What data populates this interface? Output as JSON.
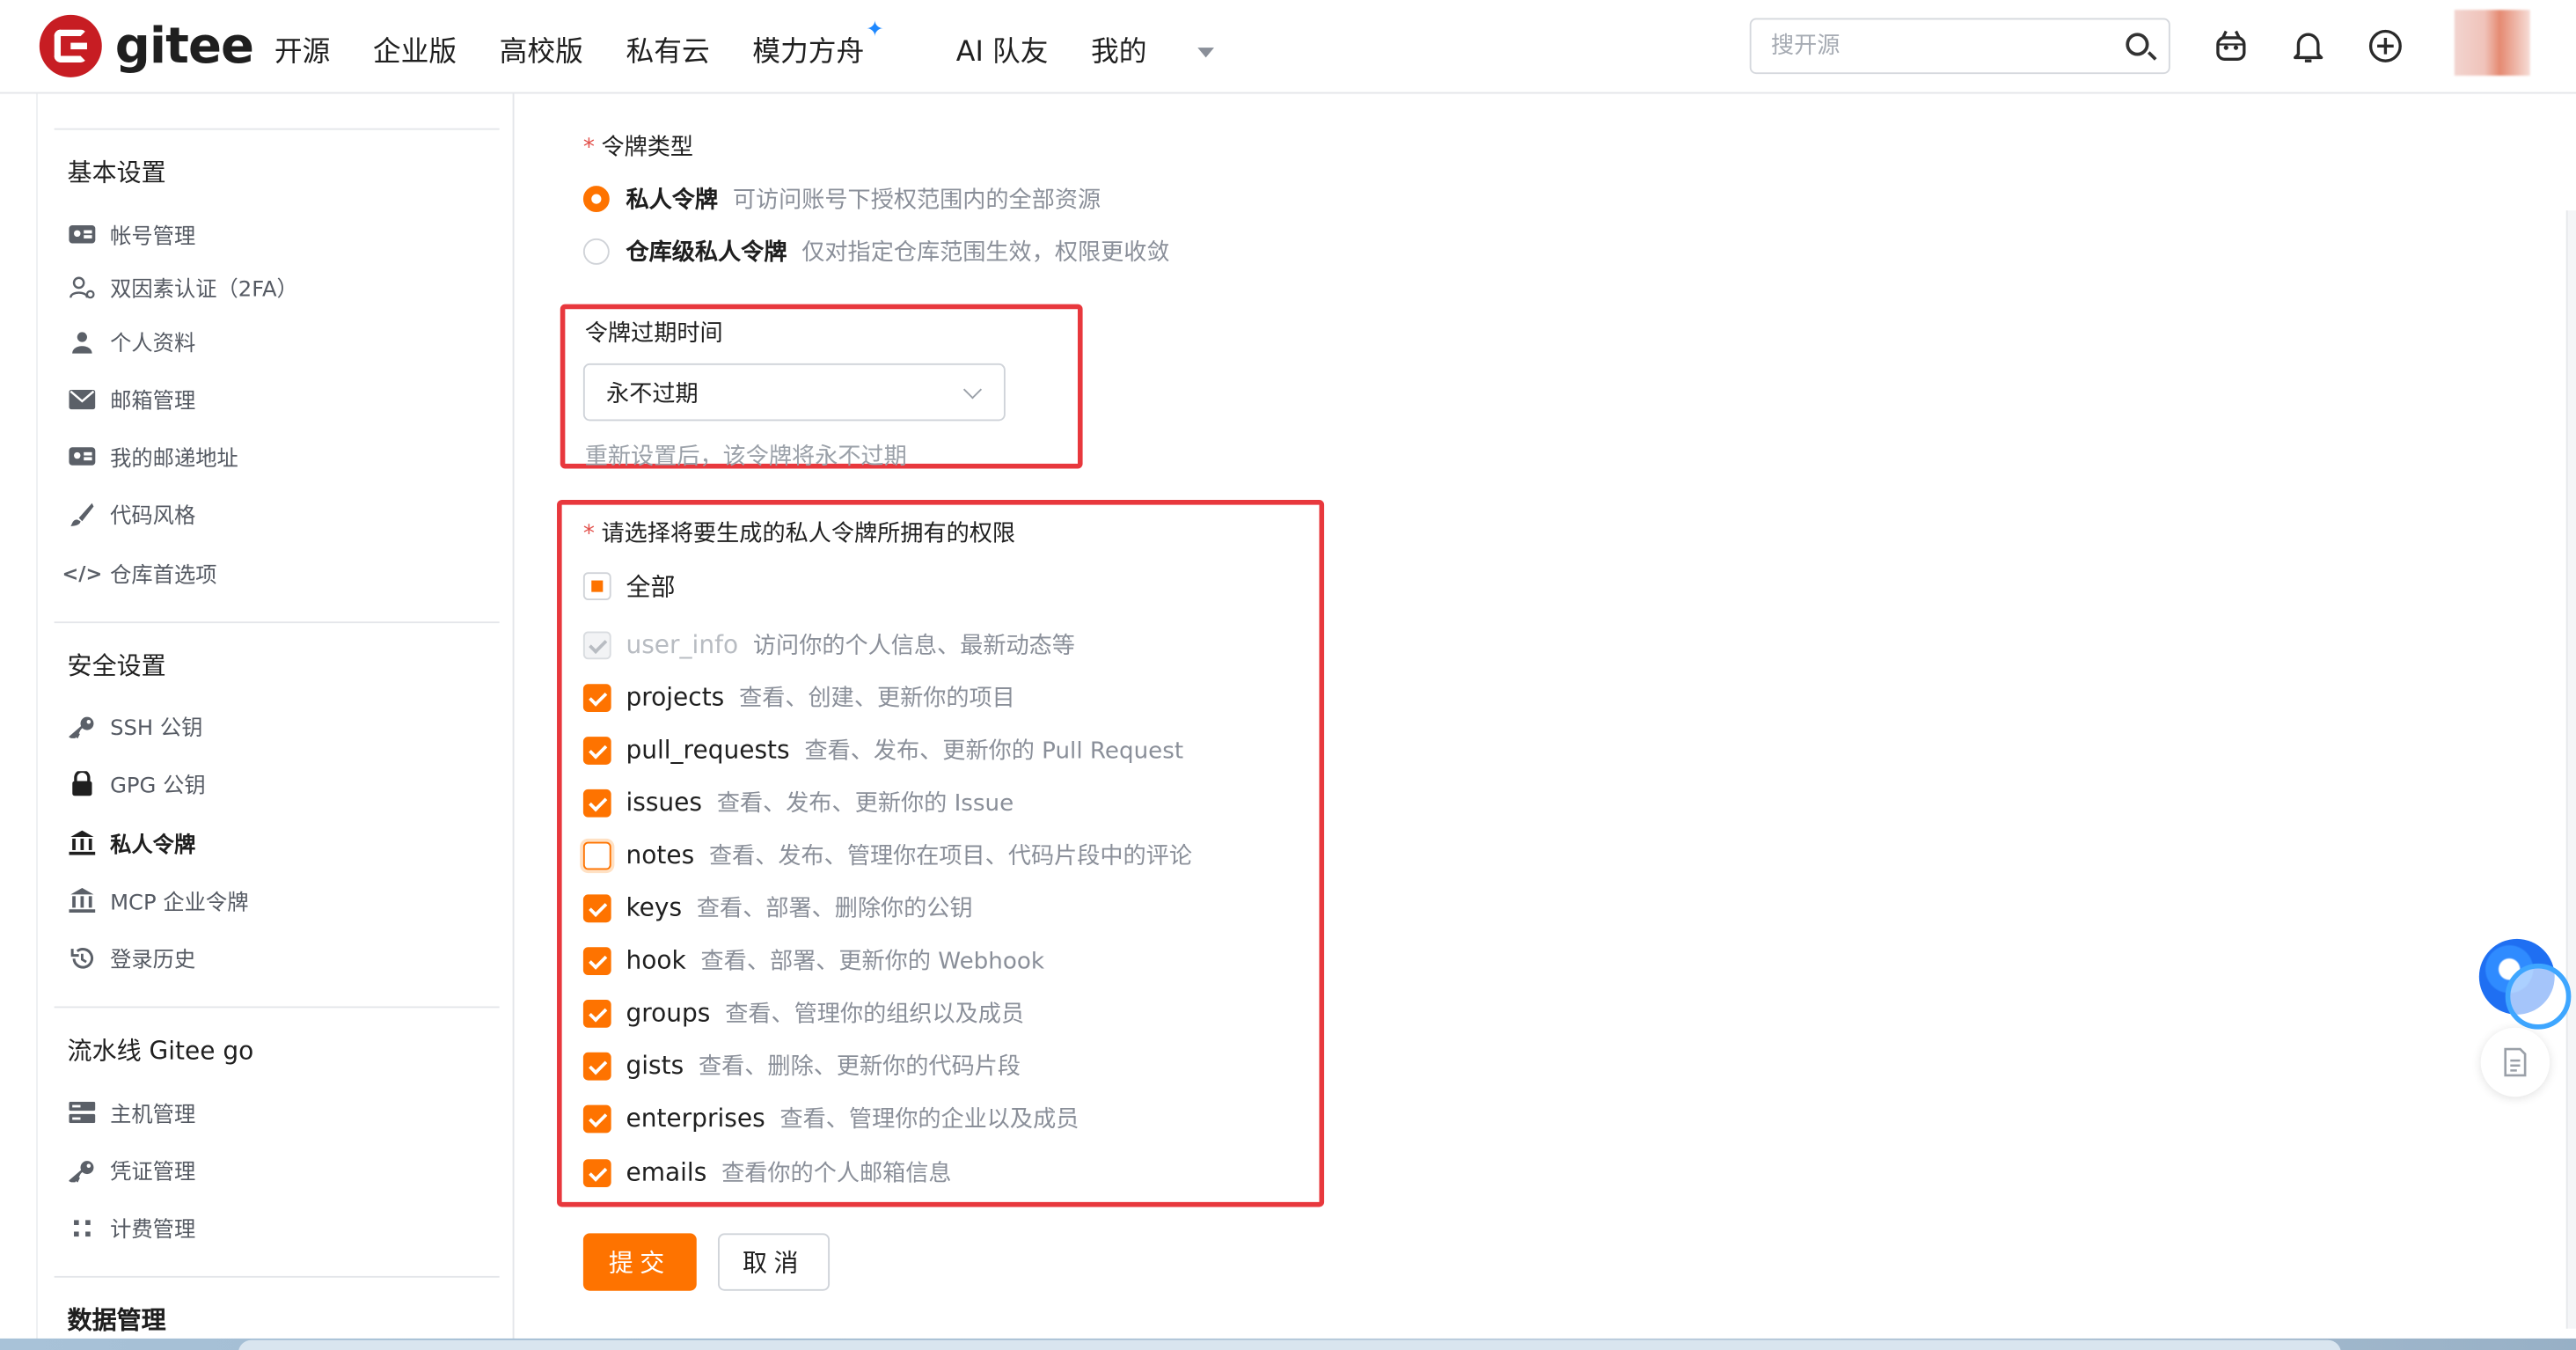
{
  "brand": {
    "name": "gitee",
    "accent": "#fe7300",
    "logo_red": "#c71d23"
  },
  "nav": {
    "items": [
      "开源",
      "企业版",
      "高校版",
      "私有云",
      "模力方舟",
      "AI 队友",
      "我的"
    ],
    "search_placeholder": "搜开源",
    "icons": [
      "search-icon",
      "robot-icon",
      "bell-icon",
      "plus-circle-icon",
      "avatar"
    ]
  },
  "sidebar": {
    "sections": [
      {
        "title": "基本设置",
        "items": [
          {
            "label": "帐号管理",
            "icon": "id-card-icon"
          },
          {
            "label": "双因素认证（2FA）",
            "icon": "user-shield-icon"
          },
          {
            "label": "个人资料",
            "icon": "user-icon"
          },
          {
            "label": "邮箱管理",
            "icon": "envelope-icon"
          },
          {
            "label": "我的邮递地址",
            "icon": "id-card-icon"
          },
          {
            "label": "代码风格",
            "icon": "brush-icon"
          },
          {
            "label": "仓库首选项",
            "icon": "code-icon"
          }
        ]
      },
      {
        "title": "安全设置",
        "items": [
          {
            "label": "SSH 公钥",
            "icon": "key-icon"
          },
          {
            "label": "GPG 公钥",
            "icon": "lock-icon"
          },
          {
            "label": "私人令牌",
            "icon": "token-icon",
            "active": true
          },
          {
            "label": "MCP 企业令牌",
            "icon": "token-icon"
          },
          {
            "label": "登录历史",
            "icon": "history-icon"
          }
        ]
      },
      {
        "title": "流水线 Gitee go",
        "items": [
          {
            "label": "主机管理",
            "icon": "server-icon"
          },
          {
            "label": "凭证管理",
            "icon": "key-icon"
          },
          {
            "label": "计费管理",
            "icon": "billing-icon"
          }
        ]
      },
      {
        "title": "数据管理",
        "items": []
      }
    ]
  },
  "form": {
    "token_type": {
      "label": "令牌类型",
      "options": [
        {
          "name": "私人令牌",
          "desc": "可访问账号下授权范围内的全部资源",
          "selected": true
        },
        {
          "name": "仓库级私人令牌",
          "desc": "仅对指定仓库范围生效，权限更收敛",
          "selected": false
        }
      ]
    },
    "expiry": {
      "label": "令牌过期时间",
      "value": "永不过期",
      "hint": "重新设置后，该令牌将永不过期"
    },
    "permissions": {
      "label": "请选择将要生成的私人令牌所拥有的权限",
      "all_label": "全部",
      "items": [
        {
          "name": "user_info",
          "desc": "访问你的个人信息、最新动态等",
          "checked": true,
          "disabled": true
        },
        {
          "name": "projects",
          "desc": "查看、创建、更新你的项目",
          "checked": true
        },
        {
          "name": "pull_requests",
          "desc": "查看、发布、更新你的 Pull Request",
          "checked": true
        },
        {
          "name": "issues",
          "desc": "查看、发布、更新你的 Issue",
          "checked": true
        },
        {
          "name": "notes",
          "desc": "查看、发布、管理你在项目、代码片段中的评论",
          "checked": false
        },
        {
          "name": "keys",
          "desc": "查看、部署、删除你的公钥",
          "checked": true
        },
        {
          "name": "hook",
          "desc": "查看、部署、更新你的 Webhook",
          "checked": true
        },
        {
          "name": "groups",
          "desc": "查看、管理你的组织以及成员",
          "checked": true
        },
        {
          "name": "gists",
          "desc": "查看、删除、更新你的代码片段",
          "checked": true
        },
        {
          "name": "enterprises",
          "desc": "查看、管理你的企业以及成员",
          "checked": true
        },
        {
          "name": "emails",
          "desc": "查看你的个人邮箱信息",
          "checked": true
        }
      ]
    },
    "submit_label": "提交",
    "cancel_label": "取消"
  }
}
